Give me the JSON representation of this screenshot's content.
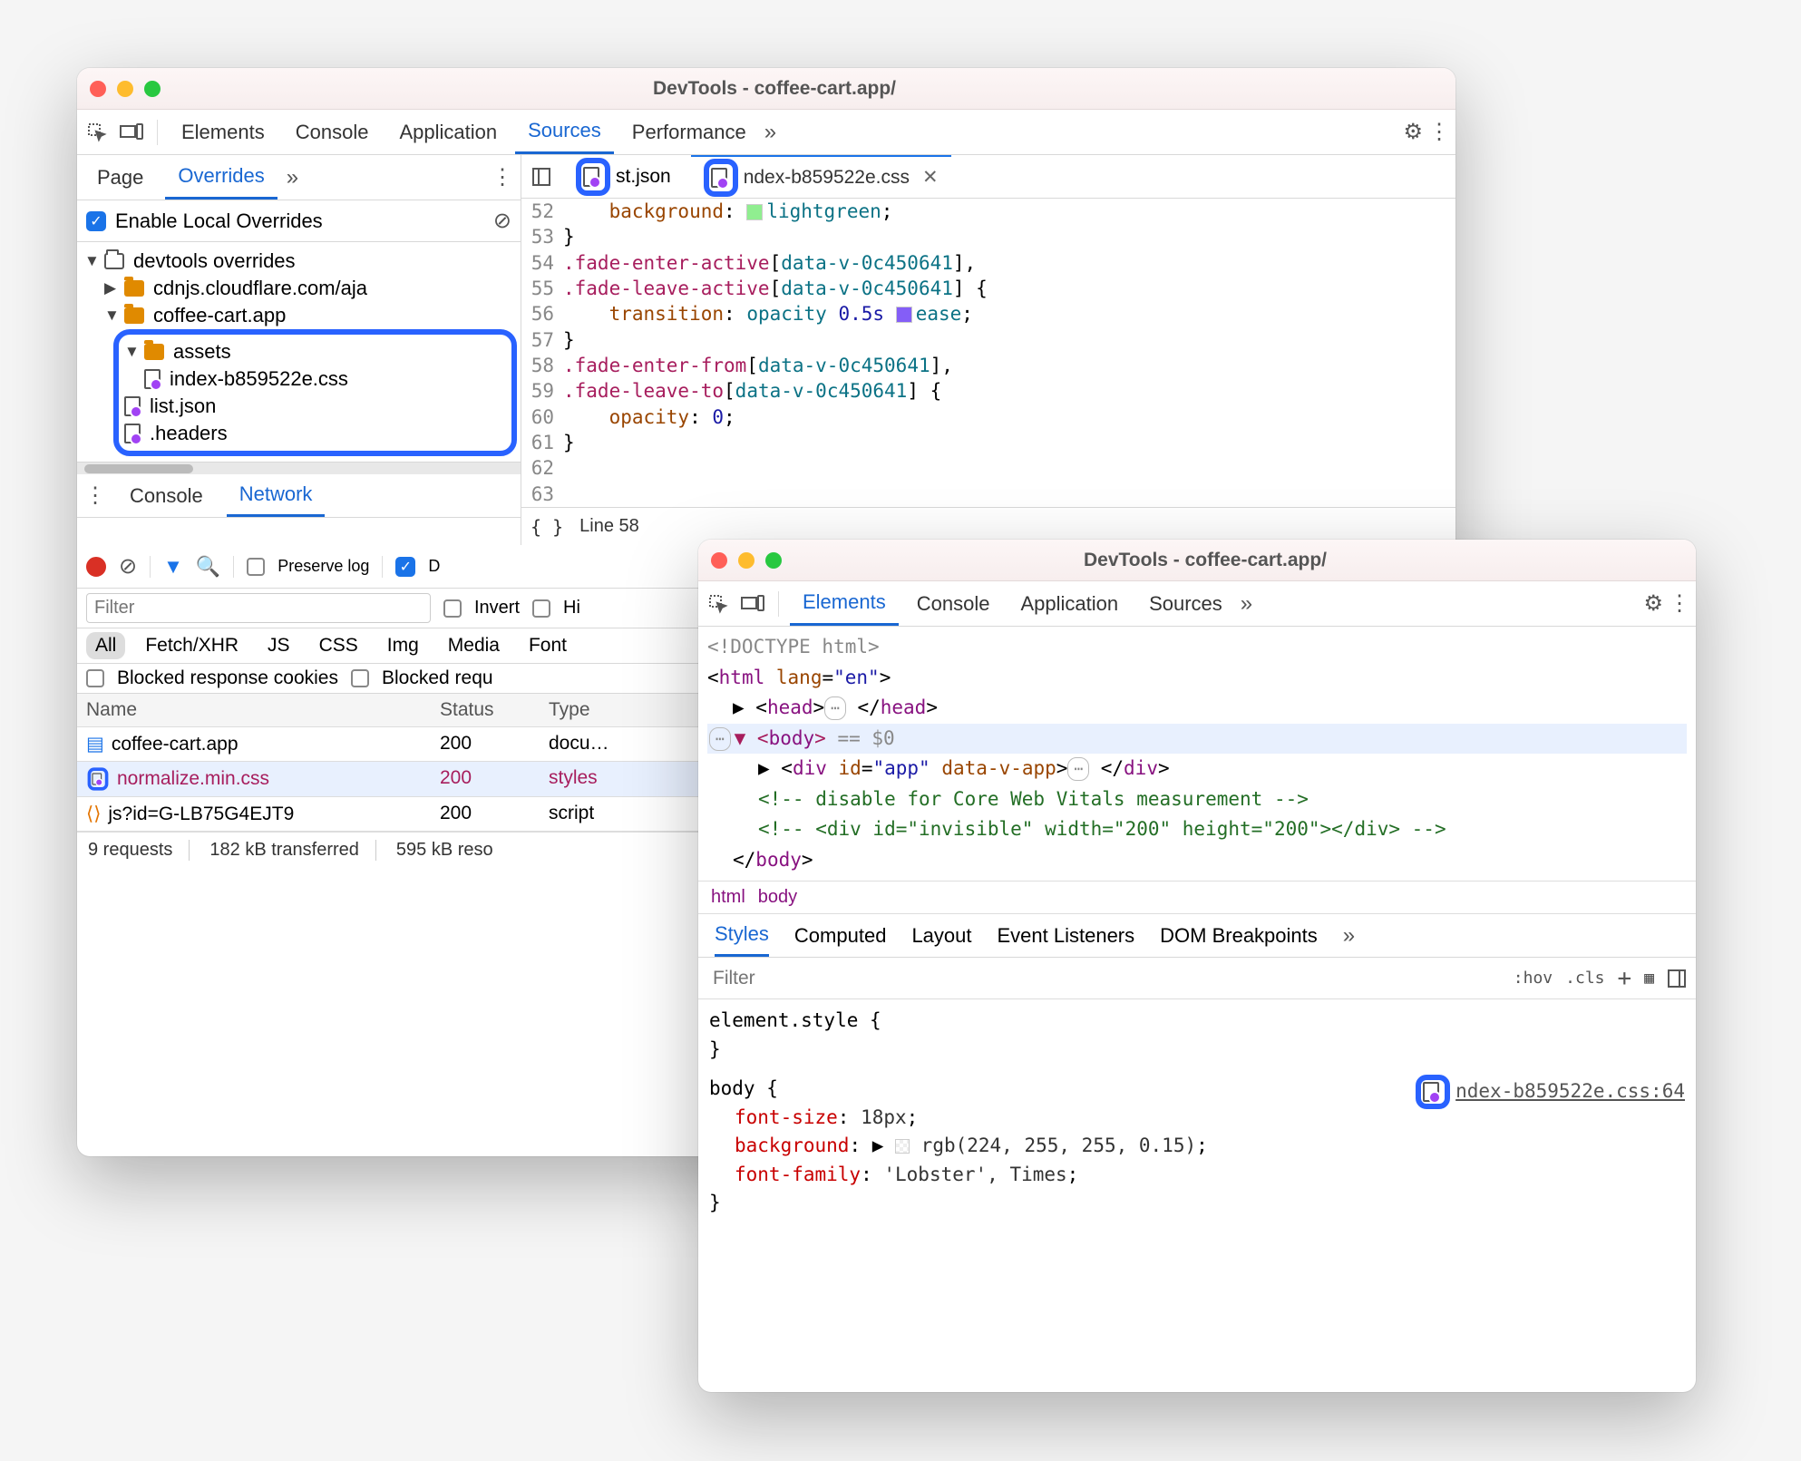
{
  "win1": {
    "title": "DevTools - coffee-cart.app/",
    "tabs": [
      "Elements",
      "Console",
      "Application",
      "Sources",
      "Performance"
    ],
    "active_tab": "Sources",
    "sub_tabs": [
      "Page",
      "Overrides"
    ],
    "active_sub": "Overrides",
    "enable_label": "Enable Local Overrides",
    "tree": {
      "root": "devtools overrides",
      "nodes": [
        {
          "label": "cdnjs.cloudflare.com/aja"
        },
        {
          "label": "coffee-cart.app",
          "children": [
            {
              "label": "assets",
              "children": [
                {
                  "label": "index-b859522e.css",
                  "dot": true
                }
              ]
            },
            {
              "label": "list.json",
              "dot": true
            },
            {
              "label": ".headers",
              "dot": true
            }
          ]
        }
      ]
    },
    "editor_tabs": [
      {
        "label": "st.json"
      },
      {
        "label": "ndex-b859522e.css",
        "close": true,
        "active": true
      }
    ],
    "code": {
      "start": 52,
      "lines": [
        "    background: lightgreen;",
        "}",
        ".fade-enter-active[data-v-0c450641],",
        ".fade-leave-active[data-v-0c450641] {",
        "    transition: opacity 0.5s ease;",
        "}",
        ".fade-enter-from[data-v-0c450641],",
        ".fade-leave-to[data-v-0c450641] {",
        "    opacity: 0;",
        "}",
        "",
        ""
      ]
    },
    "status": {
      "pretty": "{ }",
      "line": "Line 58"
    },
    "drawer_tabs": [
      "Console",
      "Network"
    ],
    "drawer_active": "Network",
    "filter_placeholder": "Filter",
    "invert": "Invert",
    "hide": "Hi",
    "chips": [
      "All",
      "Fetch/XHR",
      "JS",
      "CSS",
      "Img",
      "Media",
      "Font"
    ],
    "checks": [
      "Blocked response cookies",
      "Blocked requ"
    ],
    "preserve": "Preserve log",
    "disable": "D",
    "table": {
      "headers": [
        "Name",
        "Status",
        "Type"
      ],
      "rows": [
        {
          "icon": "doc",
          "name": "coffee-cart.app",
          "status": "200",
          "type": "docu…"
        },
        {
          "icon": "filedot",
          "name": "normalize.min.css",
          "status": "200",
          "type": "styles"
        },
        {
          "icon": "js",
          "name": "js?id=G-LB75G4EJT9",
          "status": "200",
          "type": "script"
        }
      ]
    },
    "footer": [
      "9 requests",
      "182 kB transferred",
      "595 kB reso"
    ]
  },
  "win2": {
    "title": "DevTools - coffee-cart.app/",
    "tabs": [
      "Elements",
      "Console",
      "Application",
      "Sources"
    ],
    "active_tab": "Elements",
    "dom": {
      "l1": "<!DOCTYPE html>",
      "l2a": "html",
      "l2b": "lang",
      "l2c": "\"en\"",
      "l3": "head",
      "body": "body",
      "eq": " == $0",
      "div_id": "\"app\"",
      "div_attr": "data-v-app",
      "c1": "<!-- disable for Core Web Vitals measurement -->",
      "c2": "<!-- <div id=\"invisible\" width=\"200\" height=\"200\"></div> -->"
    },
    "crumbs": [
      "html",
      "body"
    ],
    "style_tabs": [
      "Styles",
      "Computed",
      "Layout",
      "Event Listeners",
      "DOM Breakpoints"
    ],
    "style_active": "Styles",
    "filter_placeholder": "Filter",
    "hov": ":hov",
    "cls": ".cls",
    "element_style": "element.style {",
    "body_rule": "body {",
    "src_link": "ndex-b859522e.css:64",
    "props": [
      {
        "n": "font-size",
        "v": "18px"
      },
      {
        "n": "background",
        "v": "rgb(224, 255, 255, 0.15)",
        "swatch": true
      },
      {
        "n": "font-family",
        "v": "'Lobster', Times"
      }
    ]
  }
}
